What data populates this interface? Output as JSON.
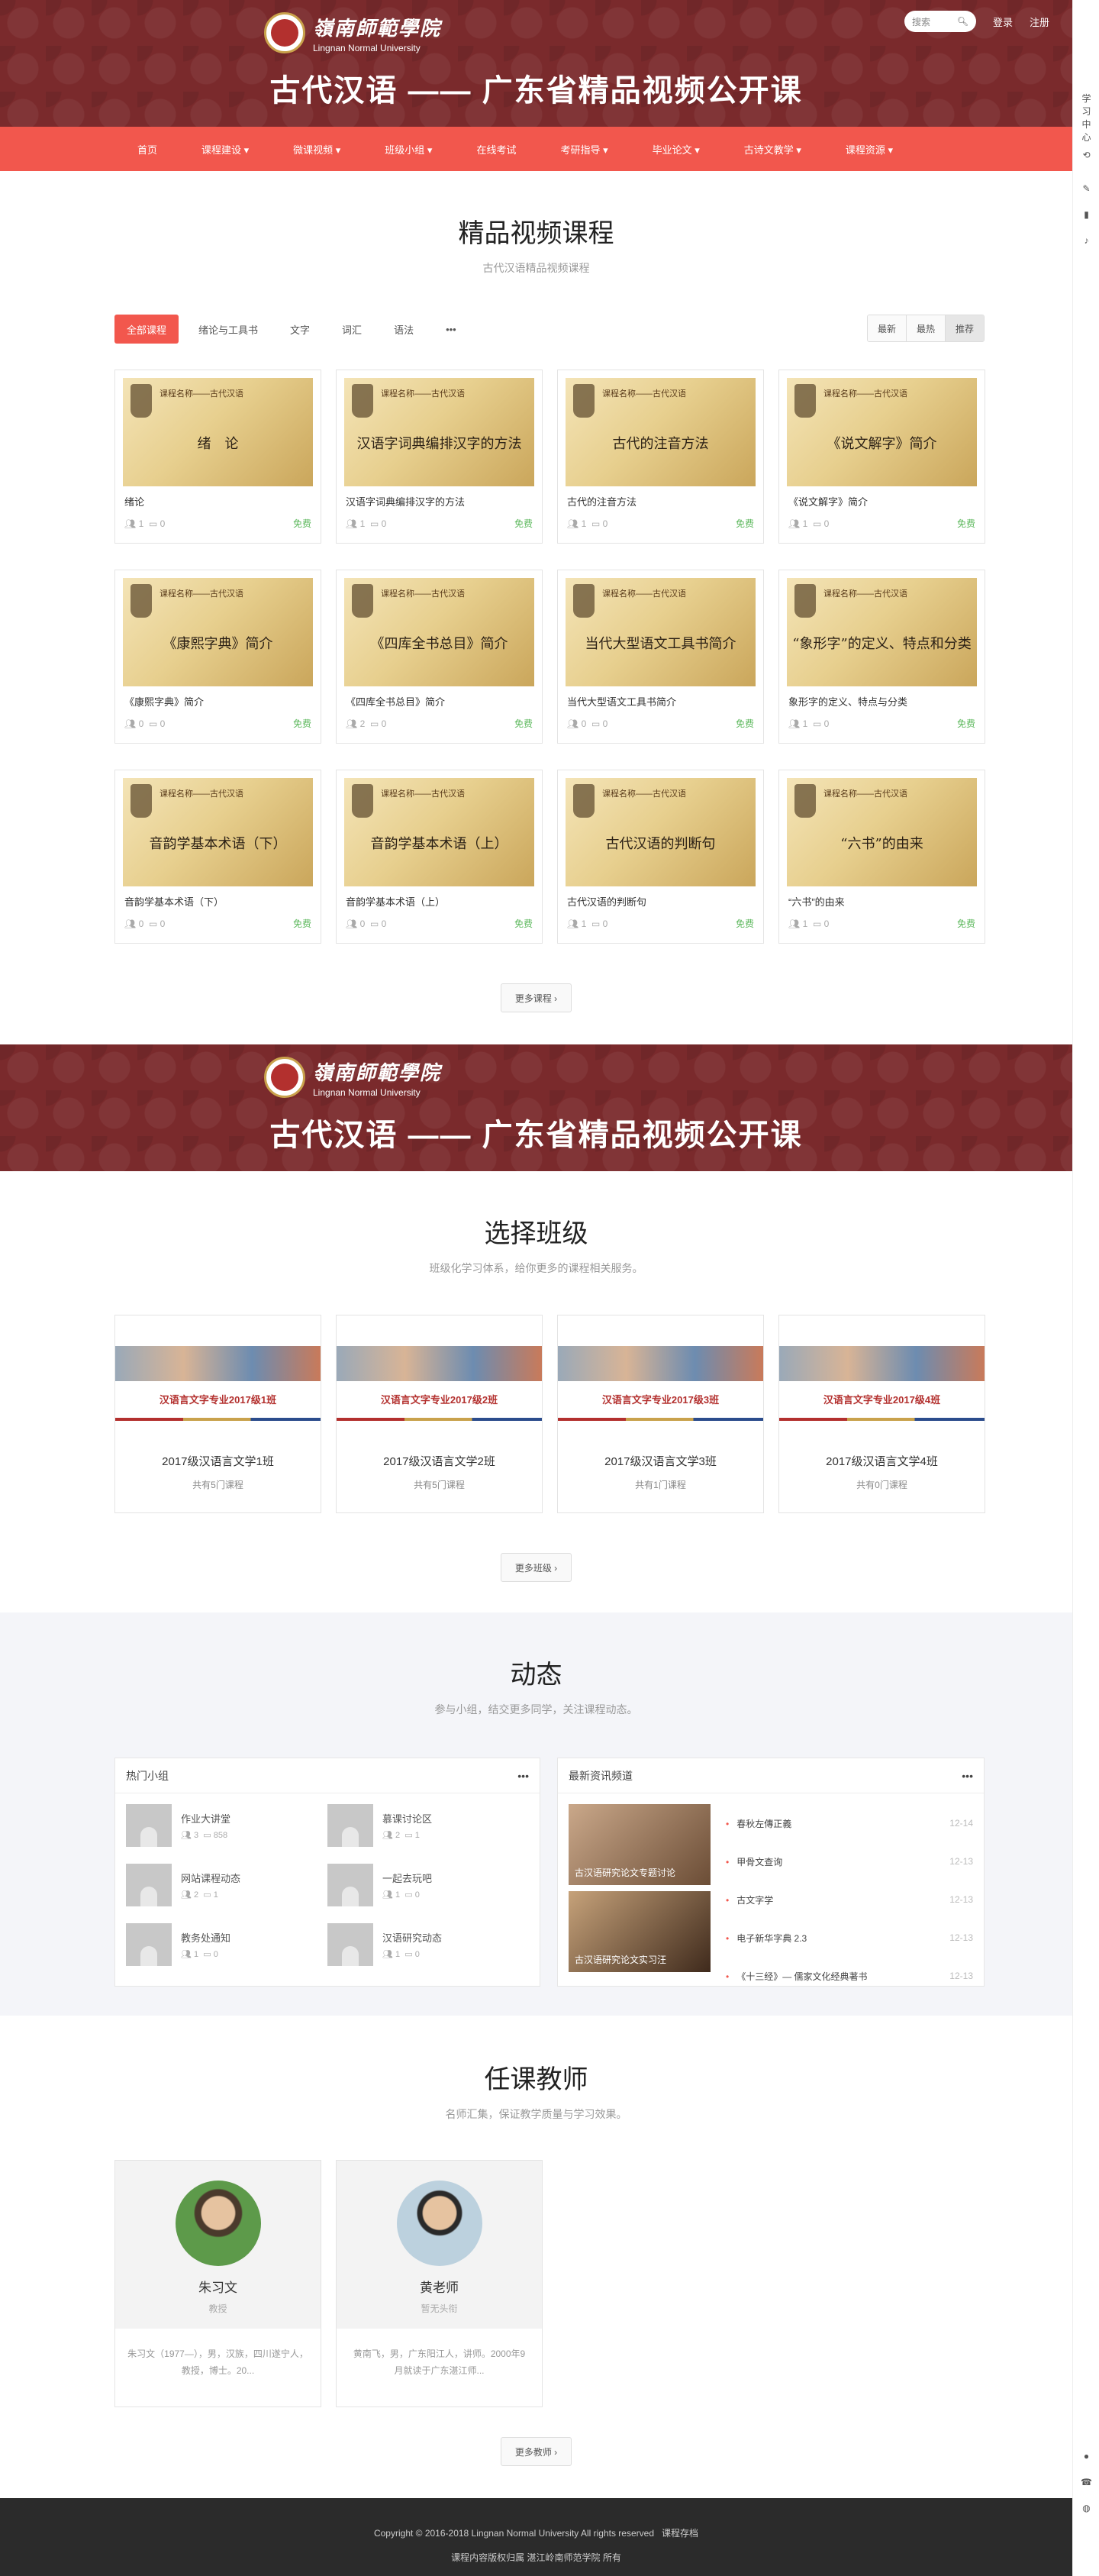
{
  "site": {
    "school_cn": "嶺南師範學院",
    "school_en": "Lingnan Normal University",
    "course_title": "古代汉语 —— 广东省精品视频公开课"
  },
  "header": {
    "search_placeholder": "搜索",
    "login": "登录",
    "register": "注册"
  },
  "nav": [
    "首页",
    "课程建设 ▾",
    "微课视频 ▾",
    "班级小组 ▾",
    "在线考试",
    "考研指导 ▾",
    "毕业论文 ▾",
    "古诗文教学 ▾",
    "课程资源 ▾"
  ],
  "courses_section": {
    "title": "精品视频课程",
    "subtitle": "古代汉语精品视频课程",
    "filters": [
      "全部课程",
      "绪论与工具书",
      "文字",
      "词汇",
      "语法",
      "•••"
    ],
    "sorts": [
      "最新",
      "最热",
      "推荐"
    ],
    "thumb_header": "课程名称——古代汉语",
    "items": [
      {
        "thumb": "绪　论",
        "name": "绪论",
        "students": "1",
        "comments": "0",
        "price": "免费"
      },
      {
        "thumb": "汉语字词典编排汉字的方法",
        "name": "汉语字词典编排汉字的方法",
        "students": "1",
        "comments": "0",
        "price": "免费"
      },
      {
        "thumb": "古代的注音方法",
        "name": "古代的注音方法",
        "students": "1",
        "comments": "0",
        "price": "免费"
      },
      {
        "thumb": "《说文解字》简介",
        "name": "《说文解字》简介",
        "students": "1",
        "comments": "0",
        "price": "免费"
      },
      {
        "thumb": "《康熙字典》简介",
        "name": "《康熙字典》简介",
        "students": "0",
        "comments": "0",
        "price": "免费"
      },
      {
        "thumb": "《四库全书总目》简介",
        "name": "《四库全书总目》简介",
        "students": "2",
        "comments": "0",
        "price": "免费"
      },
      {
        "thumb": "当代大型语文工具书简介",
        "name": "当代大型语文工具书简介",
        "students": "0",
        "comments": "0",
        "price": "免费"
      },
      {
        "thumb": "“象形字”的定义、特点和分类",
        "name": "象形字的定义、特点与分类",
        "students": "1",
        "comments": "0",
        "price": "免费"
      },
      {
        "thumb": "音韵学基本术语（下）",
        "name": "音韵学基本术语（下）",
        "students": "0",
        "comments": "0",
        "price": "免费"
      },
      {
        "thumb": "音韵学基本术语（上）",
        "name": "音韵学基本术语（上）",
        "students": "0",
        "comments": "0",
        "price": "免费"
      },
      {
        "thumb": "古代汉语的判断句",
        "name": "古代汉语的判断句",
        "students": "1",
        "comments": "0",
        "price": "免费"
      },
      {
        "thumb": "“六书”的由来",
        "name": "“六书”的由来",
        "students": "1",
        "comments": "0",
        "price": "免费"
      }
    ],
    "more": "更多课程 ›"
  },
  "classes_section": {
    "title": "选择班级",
    "subtitle": "班级化学习体系，给你更多的课程相关服务。",
    "items": [
      {
        "banner": "汉语言文字专业2017级1班",
        "name": "2017级汉语言文学1班",
        "count": "共有5门课程"
      },
      {
        "banner": "汉语言文字专业2017级2班",
        "name": "2017级汉语言文学2班",
        "count": "共有5门课程"
      },
      {
        "banner": "汉语言文字专业2017级3班",
        "name": "2017级汉语言文学3班",
        "count": "共有1门课程"
      },
      {
        "banner": "汉语言文字专业2017级4班",
        "name": "2017级汉语言文学4班",
        "count": "共有0门课程"
      }
    ],
    "more": "更多班级 ›"
  },
  "dynamic_section": {
    "title": "动态",
    "subtitle": "参与小组，结交更多同学，关注课程动态。",
    "groups_title": "热门小组",
    "news_title": "最新资讯频道",
    "more_icon": "•••",
    "groups": [
      {
        "name": "作业大讲堂",
        "members": "3",
        "posts": "858"
      },
      {
        "name": "慕课讨论区",
        "members": "2",
        "posts": "1"
      },
      {
        "name": "网站课程动态",
        "members": "2",
        "posts": "1"
      },
      {
        "name": "一起去玩吧",
        "members": "1",
        "posts": "0"
      },
      {
        "name": "教务处通知",
        "members": "1",
        "posts": "0"
      },
      {
        "name": "汉语研究动态",
        "members": "1",
        "posts": "0"
      }
    ],
    "news_images": [
      "古汉语研究论文专题讨论",
      "古汉语研究论文实习汪"
    ],
    "news": [
      {
        "title": "春秋左傳正義",
        "date": "12-14"
      },
      {
        "title": "甲骨文查询",
        "date": "12-13"
      },
      {
        "title": "古文字学",
        "date": "12-13"
      },
      {
        "title": "电子新华字典 2.3",
        "date": "12-13"
      },
      {
        "title": "《十三经》— 儒家文化经典著书",
        "date": "12-13"
      }
    ]
  },
  "teachers_section": {
    "title": "任课教师",
    "subtitle": "名师汇集，保证教学质量与学习效果。",
    "items": [
      {
        "name": "朱习文",
        "role": "教授",
        "desc": "朱习文（1977—），男，汉族，四川遂宁人，教授，博士。20..."
      },
      {
        "name": "黄老师",
        "role": "暂无头衔",
        "desc": "黄南飞，男，广东阳江人，讲师。2000年9月就读于广东湛江师..."
      }
    ],
    "more": "更多教师 ›"
  },
  "footer": {
    "line1": "Copyright © 2016-2018 Lingnan Normal University All rights reserved",
    "line1_link": "课程存档",
    "line2": "课程内容版权归属 湛江岭南师范学院 所有"
  },
  "sidebar": [
    "学",
    "习",
    "中",
    "心"
  ]
}
